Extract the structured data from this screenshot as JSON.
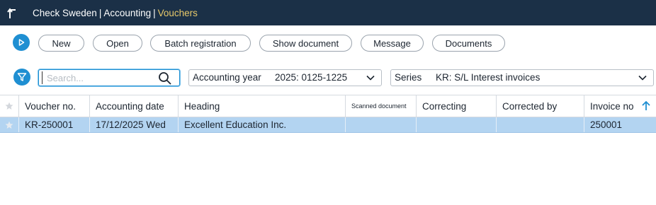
{
  "header": {
    "breadcrumbs": [
      "Check Sweden",
      "Accounting",
      "Vouchers"
    ],
    "separator": "|",
    "back_icon": "back-arrow-icon"
  },
  "toolbar": {
    "buttons": [
      "New",
      "Open",
      "Batch registration",
      "Show document",
      "Message",
      "Documents"
    ],
    "run_icon": "play-icon"
  },
  "filters": {
    "search_placeholder": "Search...",
    "search_value": "",
    "accounting_year": {
      "label": "Accounting year",
      "value": "2025: 0125-1225"
    },
    "series": {
      "label": "Series",
      "value": "KR: S/L Interest invoices"
    }
  },
  "table": {
    "columns": [
      "Voucher no.",
      "Accounting date",
      "Heading",
      "Scanned document",
      "Correcting",
      "Corrected by",
      "Invoice no"
    ],
    "sort_column": "Invoice no",
    "sort_direction": "ascending",
    "rows": [
      [
        "KR-250001",
        "17/12/2025 Wed",
        "Excellent Education Inc.",
        "",
        "",
        "",
        "250001"
      ]
    ],
    "selected_row_color": "#b3d4f1"
  },
  "colors": {
    "topbar": "#1b3047",
    "accent": "#1f8fd2",
    "breadcrumb_current": "#e8c96a"
  }
}
